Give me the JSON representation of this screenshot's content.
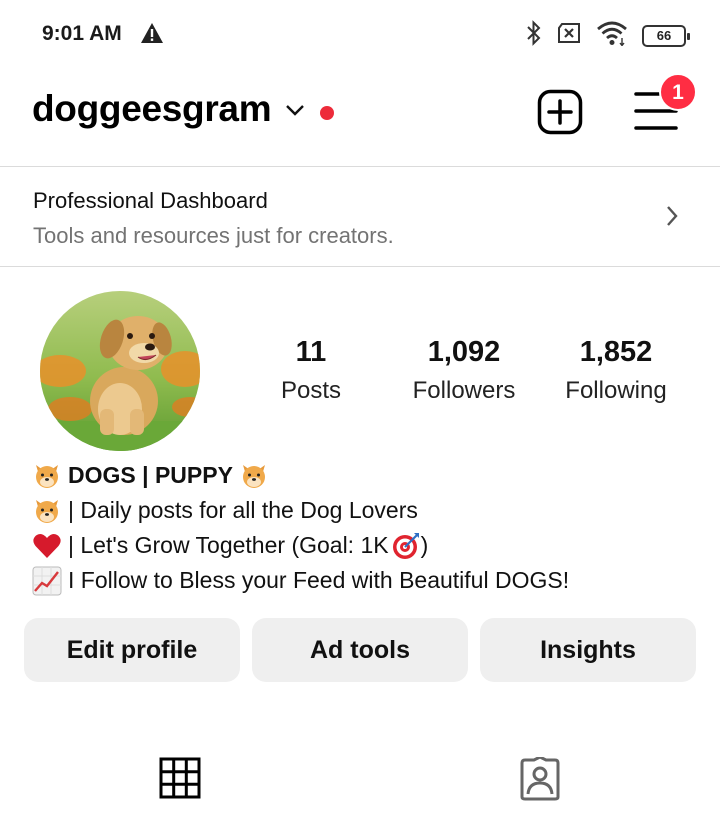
{
  "status_bar": {
    "time": "9:01 AM",
    "battery_level": "66",
    "icons": [
      "warning-icon",
      "bluetooth-icon",
      "no-sim-icon",
      "wifi-icon",
      "battery-icon"
    ]
  },
  "header": {
    "username": "doggeesgram",
    "notification_count": "1",
    "icons": [
      "chevron-down-icon",
      "new-post-icon",
      "menu-icon"
    ],
    "accent": "#ed2b3a"
  },
  "dashboard": {
    "title": "Professional Dashboard",
    "subtitle": "Tools and resources just for creators."
  },
  "profile": {
    "stats": [
      {
        "value": "11",
        "label": "Posts"
      },
      {
        "value": "1,092",
        "label": "Followers"
      },
      {
        "value": "1,852",
        "label": "Following"
      }
    ],
    "bio": [
      "DOGS | PUPPY",
      "| Daily posts for all the Dog Lovers",
      "| Let's Grow Together (Goal: 1K",
      ")",
      "I Follow to Bless your Feed with Beautiful DOGS!"
    ]
  },
  "actions": {
    "edit_profile": "Edit profile",
    "ad_tools": "Ad tools",
    "insights": "Insights"
  },
  "tabs": [
    "grid-icon",
    "tagged-icon"
  ]
}
